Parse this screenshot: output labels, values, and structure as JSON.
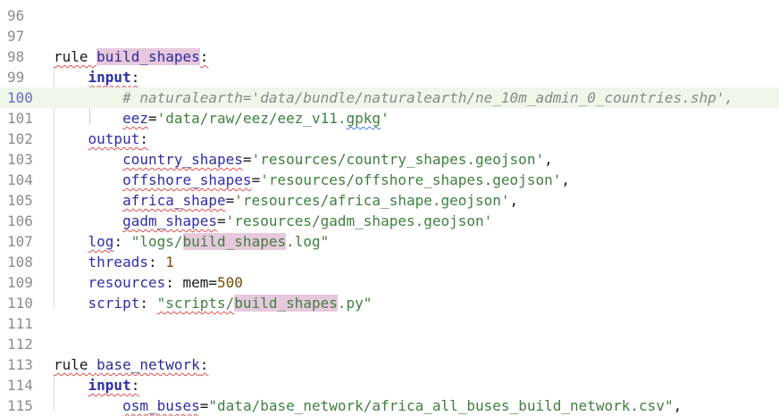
{
  "editor": {
    "colors": {
      "background": "#ffffff",
      "current_line": "#eef7e8",
      "string": "#3f7f3f",
      "keyword": "#1a1a1a",
      "identifier": "#2b2b9a",
      "number": "#7a4a00",
      "comment": "#8a8a8a",
      "highlight": "#e7c8dd"
    },
    "lines": [
      {
        "no": "96",
        "parts": []
      },
      {
        "no": "97",
        "parts": []
      },
      {
        "no": "98",
        "parts": [
          {
            "t": "rule ",
            "c": "kw squig"
          },
          {
            "t": "build_shapes",
            "c": "id hl"
          },
          {
            "t": ":",
            "c": "kw squig"
          }
        ]
      },
      {
        "no": "99",
        "parts": [
          {
            "t": "    "
          },
          {
            "t": "input",
            "c": "key bold squig"
          },
          {
            "t": ":",
            "c": "kw squig"
          }
        ]
      },
      {
        "no": "100",
        "current": true,
        "parts": [
          {
            "t": "        "
          },
          {
            "t": "# naturalearth='data/bundle/naturalearth/ne_10m_admin_0_countries.shp',",
            "c": "com"
          }
        ]
      },
      {
        "no": "101",
        "parts": [
          {
            "t": "        "
          },
          {
            "t": "eez",
            "c": "key squig"
          },
          {
            "t": "=",
            "c": "kw"
          },
          {
            "t": "'data/raw/eez/eez_v11.",
            "c": "str"
          },
          {
            "t": "gpkg",
            "c": "str squig-blue"
          },
          {
            "t": "'",
            "c": "str"
          }
        ]
      },
      {
        "no": "102",
        "parts": [
          {
            "t": "    "
          },
          {
            "t": "output",
            "c": "key squig"
          },
          {
            "t": ":",
            "c": "kw squig"
          }
        ]
      },
      {
        "no": "103",
        "parts": [
          {
            "t": "        "
          },
          {
            "t": "country_shapes",
            "c": "key squig"
          },
          {
            "t": "=",
            "c": "kw"
          },
          {
            "t": "'resources/country_shapes.geojson'",
            "c": "str"
          },
          {
            "t": ",",
            "c": "kw"
          }
        ]
      },
      {
        "no": "104",
        "parts": [
          {
            "t": "        "
          },
          {
            "t": "offshore_shapes",
            "c": "key squig"
          },
          {
            "t": "=",
            "c": "kw"
          },
          {
            "t": "'resources/offshore_shapes.geojson'",
            "c": "str"
          },
          {
            "t": ",",
            "c": "kw"
          }
        ]
      },
      {
        "no": "105",
        "parts": [
          {
            "t": "        "
          },
          {
            "t": "africa_shape",
            "c": "key squig"
          },
          {
            "t": "=",
            "c": "kw"
          },
          {
            "t": "'resources/africa_shape.geojson'",
            "c": "str"
          },
          {
            "t": ",",
            "c": "kw"
          }
        ]
      },
      {
        "no": "106",
        "parts": [
          {
            "t": "        "
          },
          {
            "t": "gadm_shapes",
            "c": "key squig"
          },
          {
            "t": "=",
            "c": "kw"
          },
          {
            "t": "'resources/gadm_shapes.geojson'",
            "c": "str"
          }
        ]
      },
      {
        "no": "107",
        "parts": [
          {
            "t": "    "
          },
          {
            "t": "log",
            "c": "key squig"
          },
          {
            "t": ": ",
            "c": "kw"
          },
          {
            "t": "\"logs/",
            "c": "str"
          },
          {
            "t": "build_shapes",
            "c": "str hl"
          },
          {
            "t": ".log\"",
            "c": "str"
          }
        ]
      },
      {
        "no": "108",
        "parts": [
          {
            "t": "    "
          },
          {
            "t": "threads",
            "c": "key"
          },
          {
            "t": ": ",
            "c": "kw"
          },
          {
            "t": "1",
            "c": "num"
          }
        ]
      },
      {
        "no": "109",
        "parts": [
          {
            "t": "    "
          },
          {
            "t": "resources",
            "c": "key"
          },
          {
            "t": ": mem=",
            "c": "kw"
          },
          {
            "t": "500",
            "c": "num"
          }
        ]
      },
      {
        "no": "110",
        "parts": [
          {
            "t": "    "
          },
          {
            "t": "script",
            "c": "key"
          },
          {
            "t": ": ",
            "c": "kw"
          },
          {
            "t": "\"scripts/",
            "c": "str squig"
          },
          {
            "t": "build_shapes",
            "c": "str hl"
          },
          {
            "t": ".py\"",
            "c": "str"
          }
        ]
      },
      {
        "no": "111",
        "parts": []
      },
      {
        "no": "112",
        "parts": []
      },
      {
        "no": "113",
        "parts": [
          {
            "t": "rule ",
            "c": "kw squig"
          },
          {
            "t": "base_network",
            "c": "id squig"
          },
          {
            "t": ":",
            "c": "kw squig"
          }
        ]
      },
      {
        "no": "114",
        "parts": [
          {
            "t": "    "
          },
          {
            "t": "input",
            "c": "key bold squig"
          },
          {
            "t": ":",
            "c": "kw squig"
          }
        ]
      },
      {
        "no": "115",
        "parts": [
          {
            "t": "        "
          },
          {
            "t": "osm_buses",
            "c": "key squig"
          },
          {
            "t": "=",
            "c": "kw"
          },
          {
            "t": "\"data/base_network/africa_all_buses_build_network.csv\"",
            "c": "str"
          },
          {
            "t": ",",
            "c": "kw"
          }
        ]
      }
    ]
  }
}
